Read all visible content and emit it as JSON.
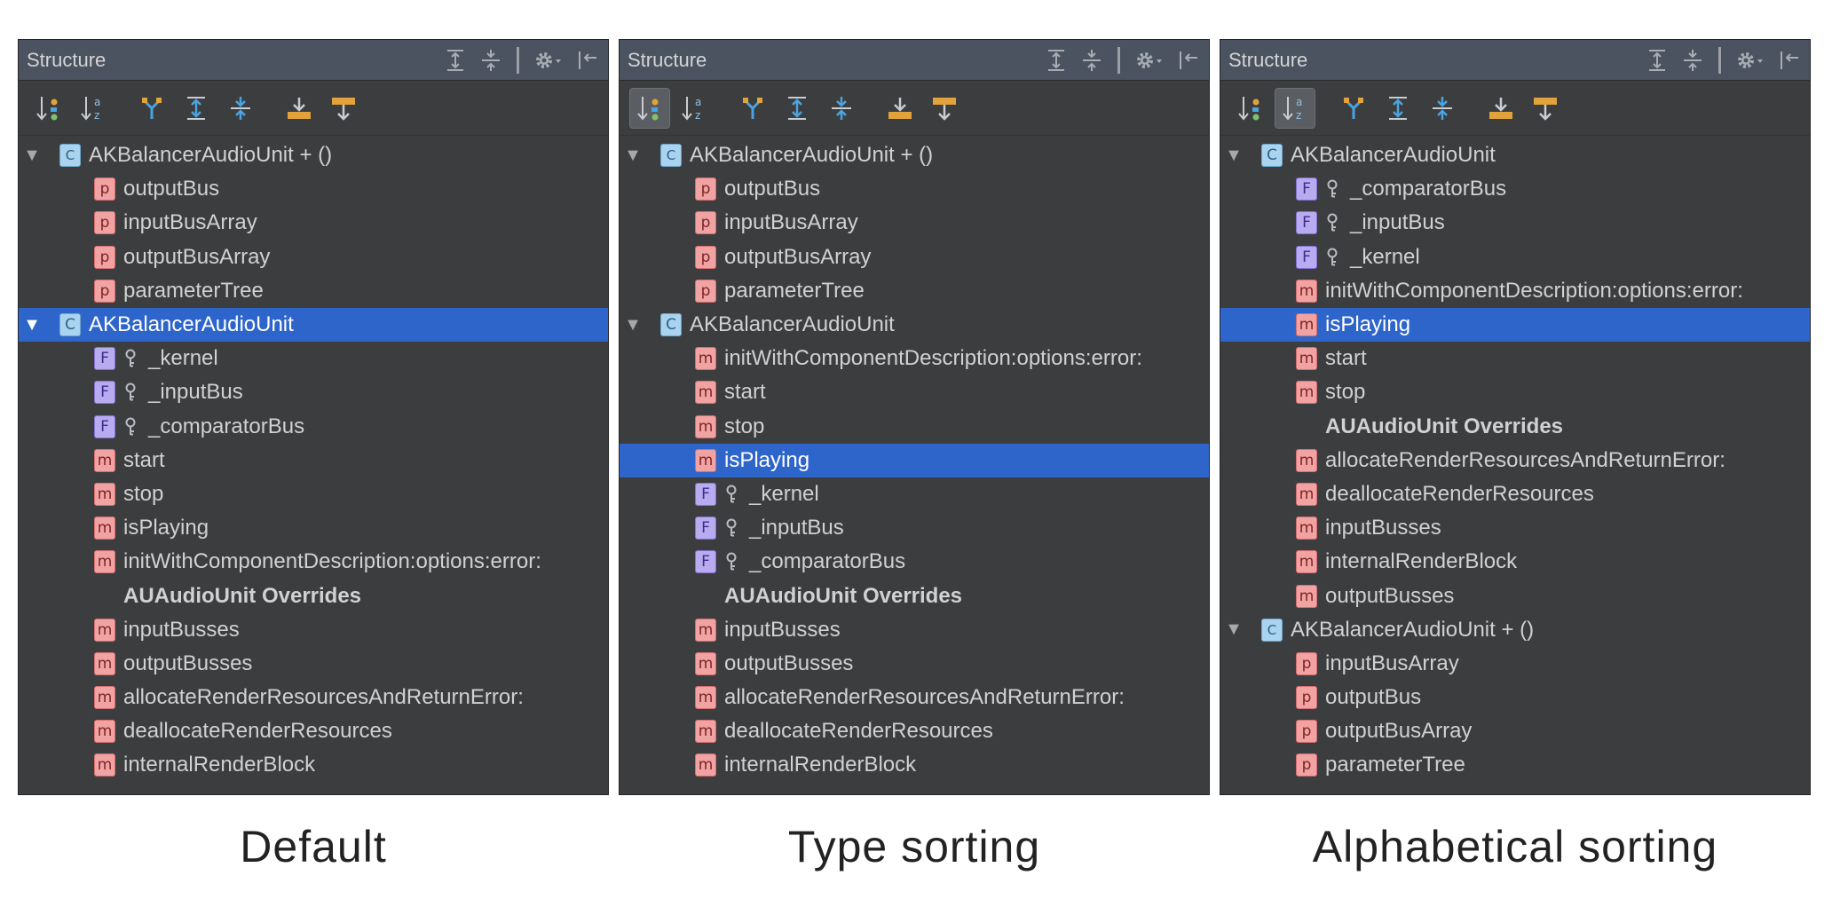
{
  "panels": [
    {
      "title": "Structure",
      "caption": "Default",
      "active_sort": "none",
      "rows": [
        {
          "kind": "class-ext",
          "arrow": "▼",
          "label": "AKBalancerAudioUnit + ()",
          "depth": 0,
          "selected": false
        },
        {
          "kind": "p",
          "label": "outputBus",
          "depth": 1,
          "selected": false
        },
        {
          "kind": "p",
          "label": "inputBusArray",
          "depth": 1,
          "selected": false
        },
        {
          "kind": "p",
          "label": "outputBusArray",
          "depth": 1,
          "selected": false
        },
        {
          "kind": "p",
          "label": "parameterTree",
          "depth": 1,
          "selected": false
        },
        {
          "kind": "class",
          "arrow": "▼",
          "label": "AKBalancerAudioUnit",
          "depth": 0,
          "selected": true
        },
        {
          "kind": "f",
          "label": "_kernel",
          "depth": 1,
          "selected": false
        },
        {
          "kind": "f",
          "label": "_inputBus",
          "depth": 1,
          "selected": false
        },
        {
          "kind": "f",
          "label": "_comparatorBus",
          "depth": 1,
          "selected": false
        },
        {
          "kind": "m",
          "label": "start",
          "depth": 1,
          "selected": false
        },
        {
          "kind": "m",
          "label": "stop",
          "depth": 1,
          "selected": false
        },
        {
          "kind": "m",
          "label": "isPlaying",
          "depth": 1,
          "selected": false
        },
        {
          "kind": "m",
          "label": "initWithComponentDescription:options:error:",
          "depth": 1,
          "selected": false
        },
        {
          "kind": "section",
          "label": "AUAudioUnit Overrides",
          "depth": 1,
          "selected": false
        },
        {
          "kind": "m",
          "label": "inputBusses",
          "depth": 1,
          "selected": false
        },
        {
          "kind": "m",
          "label": "outputBusses",
          "depth": 1,
          "selected": false
        },
        {
          "kind": "m",
          "label": "allocateRenderResourcesAndReturnError:",
          "depth": 1,
          "selected": false
        },
        {
          "kind": "m",
          "label": "deallocateRenderResources",
          "depth": 1,
          "selected": false
        },
        {
          "kind": "m",
          "label": "internalRenderBlock",
          "depth": 1,
          "selected": false
        }
      ]
    },
    {
      "title": "Structure",
      "caption": "Type sorting",
      "active_sort": "type",
      "rows": [
        {
          "kind": "class-ext",
          "arrow": "▼",
          "label": "AKBalancerAudioUnit + ()",
          "depth": 0,
          "selected": false
        },
        {
          "kind": "p",
          "label": "outputBus",
          "depth": 1,
          "selected": false
        },
        {
          "kind": "p",
          "label": "inputBusArray",
          "depth": 1,
          "selected": false
        },
        {
          "kind": "p",
          "label": "outputBusArray",
          "depth": 1,
          "selected": false
        },
        {
          "kind": "p",
          "label": "parameterTree",
          "depth": 1,
          "selected": false
        },
        {
          "kind": "class",
          "arrow": "▼",
          "label": "AKBalancerAudioUnit",
          "depth": 0,
          "selected": false
        },
        {
          "kind": "m",
          "label": "initWithComponentDescription:options:error:",
          "depth": 1,
          "selected": false
        },
        {
          "kind": "m",
          "label": "start",
          "depth": 1,
          "selected": false
        },
        {
          "kind": "m",
          "label": "stop",
          "depth": 1,
          "selected": false
        },
        {
          "kind": "m",
          "label": "isPlaying",
          "depth": 1,
          "selected": true
        },
        {
          "kind": "f",
          "label": "_kernel",
          "depth": 1,
          "selected": false
        },
        {
          "kind": "f",
          "label": "_inputBus",
          "depth": 1,
          "selected": false
        },
        {
          "kind": "f",
          "label": "_comparatorBus",
          "depth": 1,
          "selected": false
        },
        {
          "kind": "section",
          "label": "AUAudioUnit Overrides",
          "depth": 1,
          "selected": false
        },
        {
          "kind": "m",
          "label": "inputBusses",
          "depth": 1,
          "selected": false
        },
        {
          "kind": "m",
          "label": "outputBusses",
          "depth": 1,
          "selected": false
        },
        {
          "kind": "m",
          "label": "allocateRenderResourcesAndReturnError:",
          "depth": 1,
          "selected": false
        },
        {
          "kind": "m",
          "label": "deallocateRenderResources",
          "depth": 1,
          "selected": false
        },
        {
          "kind": "m",
          "label": "internalRenderBlock",
          "depth": 1,
          "selected": false
        }
      ]
    },
    {
      "title": "Structure",
      "caption": "Alphabetical sorting",
      "active_sort": "alpha",
      "rows": [
        {
          "kind": "class",
          "arrow": "▼",
          "label": "AKBalancerAudioUnit",
          "depth": 0,
          "selected": false
        },
        {
          "kind": "f",
          "label": "_comparatorBus",
          "depth": 1,
          "selected": false
        },
        {
          "kind": "f",
          "label": "_inputBus",
          "depth": 1,
          "selected": false
        },
        {
          "kind": "f",
          "label": "_kernel",
          "depth": 1,
          "selected": false
        },
        {
          "kind": "m",
          "label": "initWithComponentDescription:options:error:",
          "depth": 1,
          "selected": false
        },
        {
          "kind": "m",
          "label": "isPlaying",
          "depth": 1,
          "selected": true
        },
        {
          "kind": "m",
          "label": "start",
          "depth": 1,
          "selected": false
        },
        {
          "kind": "m",
          "label": "stop",
          "depth": 1,
          "selected": false
        },
        {
          "kind": "section",
          "label": "AUAudioUnit Overrides",
          "depth": 1,
          "selected": false
        },
        {
          "kind": "m",
          "label": "allocateRenderResourcesAndReturnError:",
          "depth": 1,
          "selected": false
        },
        {
          "kind": "m",
          "label": "deallocateRenderResources",
          "depth": 1,
          "selected": false
        },
        {
          "kind": "m",
          "label": "inputBusses",
          "depth": 1,
          "selected": false
        },
        {
          "kind": "m",
          "label": "internalRenderBlock",
          "depth": 1,
          "selected": false
        },
        {
          "kind": "m",
          "label": "outputBusses",
          "depth": 1,
          "selected": false
        },
        {
          "kind": "class-ext",
          "arrow": "▼",
          "label": "AKBalancerAudioUnit + ()",
          "depth": 0,
          "selected": false
        },
        {
          "kind": "p",
          "label": "inputBusArray",
          "depth": 1,
          "selected": false
        },
        {
          "kind": "p",
          "label": "outputBus",
          "depth": 1,
          "selected": false
        },
        {
          "kind": "p",
          "label": "outputBusArray",
          "depth": 1,
          "selected": false
        },
        {
          "kind": "p",
          "label": "parameterTree",
          "depth": 1,
          "selected": false
        }
      ]
    }
  ],
  "badge_letters": {
    "class": "C",
    "class-ext": "C",
    "p": "p",
    "m": "m",
    "f": "F"
  },
  "icons": {
    "titlebar": [
      "expand-all-icon",
      "collapse-all-icon",
      "gear-icon",
      "hide-panel-icon"
    ],
    "toolbar": [
      "sort-by-type-icon",
      "sort-alphabetically-icon",
      "show-inherited-icon",
      "expand-icon",
      "collapse-icon",
      "autoscroll-to-source-icon",
      "autoscroll-from-source-icon"
    ]
  },
  "colors": {
    "panel_bg": "#3b3d3f",
    "titlebar_bg": "#4b5260",
    "selection": "#2e65ca",
    "text": "#d1d1d1"
  }
}
